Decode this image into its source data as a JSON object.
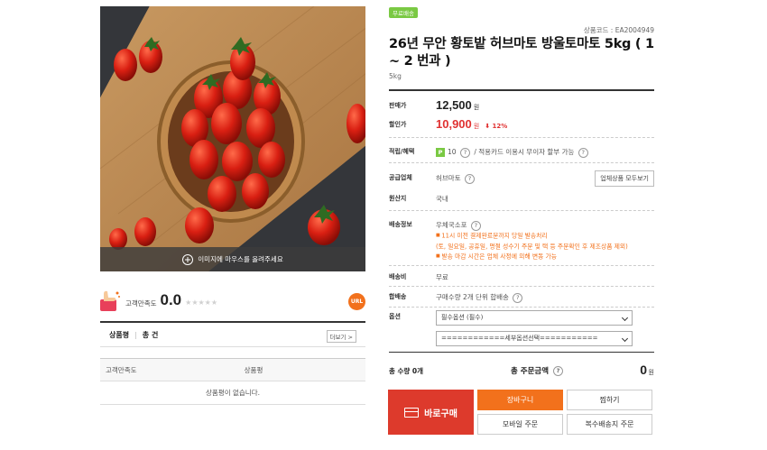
{
  "image": {
    "zoom_hint": "이미지에 마우스를 올려주세요"
  },
  "satisfaction": {
    "label": "고객만족도",
    "score": "0.0",
    "stars": "★★★★★",
    "url_badge": "URL"
  },
  "reviews": {
    "title": "상품평",
    "count": "총 건",
    "more": "더보기 >",
    "col_satisfaction": "고객만족도",
    "col_review": "상품평",
    "empty": "상품평이 없습니다."
  },
  "product": {
    "badge": "무료배송",
    "code": "상품코드 : EA2004949",
    "title": "26년 무안 황토밭 허브마토 방울토마토 5kg ( 1 ~ 2 번과 )",
    "subtitle": "5kg"
  },
  "info": {
    "sale_label": "판매가",
    "sale_price": "12,500",
    "won": "원",
    "discount_label": "할인가",
    "discount_price": "10,900",
    "discount_rate": "⬇ 12%",
    "points_label": "적립/혜택",
    "points_badge": "P",
    "points_value": "10",
    "points_note": "/ 적용카드 이용시 무이자 할부 가능",
    "supplier_label": "공급업체",
    "supplier_name": "허브마토",
    "supplier_button": "업체상품 모두보기",
    "origin_label": "원산지",
    "origin_value": "국내",
    "shipping_label": "배송정보",
    "shipping_method": "우체국소포",
    "shipping_notes": [
      "11시 이전 결제완료분까지 당일 발송처리",
      "(토, 일요일, 공휴일, 명절 성수기 주문 및 택 등 주문확인 후 제조상품 제외)",
      "발송 마감 시간은 업체 사정에 의해 변동 가능"
    ],
    "fee_label": "배송비",
    "fee_value": "무료",
    "bundle_label": "합배송",
    "bundle_value": "구매수량 2개 단위 합배송",
    "option_label": "옵션",
    "option_required": "필수옵션 (필수)",
    "option_detail": "============세부옵션선택==========="
  },
  "totals": {
    "qty": "총 수량 0개",
    "label": "총 주문금액",
    "value": "0",
    "won": "원"
  },
  "actions": {
    "buy_now": "바로구매",
    "cart": "장바구니",
    "wish": "찜하기",
    "mobile": "모바일 주문",
    "multi": "복수배송지 주문"
  },
  "colors": {
    "accent_red": "#dd3a2c",
    "accent_orange": "#f2711c",
    "free_ship_green": "#7ac943"
  }
}
